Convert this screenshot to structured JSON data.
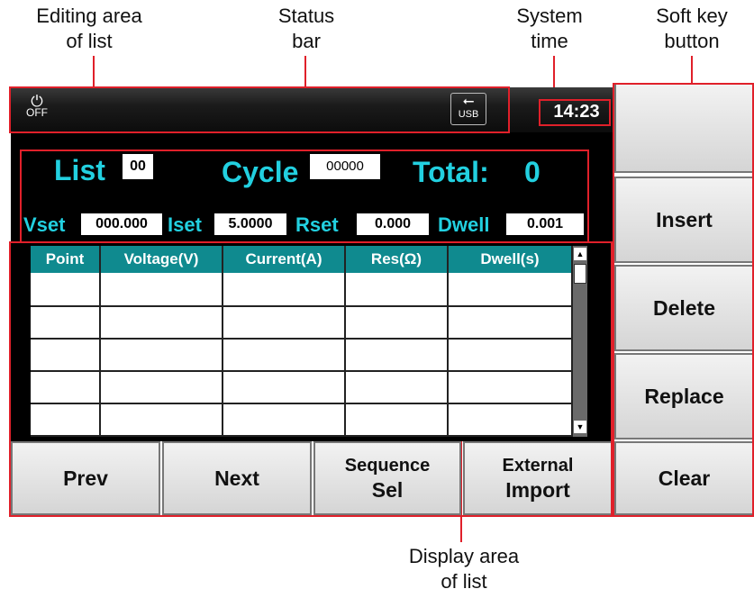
{
  "callouts": {
    "editing_area": "Editing area\nof list",
    "status_bar": "Status\nbar",
    "system_time": "System\ntime",
    "soft_key": "Soft key\nbutton",
    "display_area": "Display area\nof list"
  },
  "status": {
    "power_label": "OFF",
    "usb_label": "USB",
    "time": "14:23"
  },
  "editor": {
    "list_label": "List",
    "list_value": "00",
    "cycle_label": "Cycle",
    "cycle_value": "00000",
    "total_label": "Total:",
    "total_value": "0",
    "vset_label": "Vset",
    "vset_value": "000.000",
    "iset_label": "Iset",
    "iset_value": "5.0000",
    "rset_label": "Rset",
    "rset_value": "0.000",
    "dwell_label": "Dwell",
    "dwell_value": "0.001"
  },
  "table": {
    "columns": [
      "Point",
      "Voltage(V)",
      "Current(A)",
      "Res(Ω)",
      "Dwell(s)"
    ]
  },
  "soft_keys": {
    "k1": "",
    "k2": "Insert",
    "k3": "Delete",
    "k4": "Replace",
    "k5": "Clear"
  },
  "bottom_keys": {
    "prev": "Prev",
    "next": "Next",
    "seq_l1": "Sequence",
    "seq_l2": "Sel",
    "ext_l1": "External",
    "ext_l2": "Import"
  },
  "colors": {
    "label": "#22d0e0",
    "table_header": "#0f8a8f",
    "annotation": "#e0202a"
  },
  "icons": [
    "power-icon",
    "usb-icon"
  ]
}
